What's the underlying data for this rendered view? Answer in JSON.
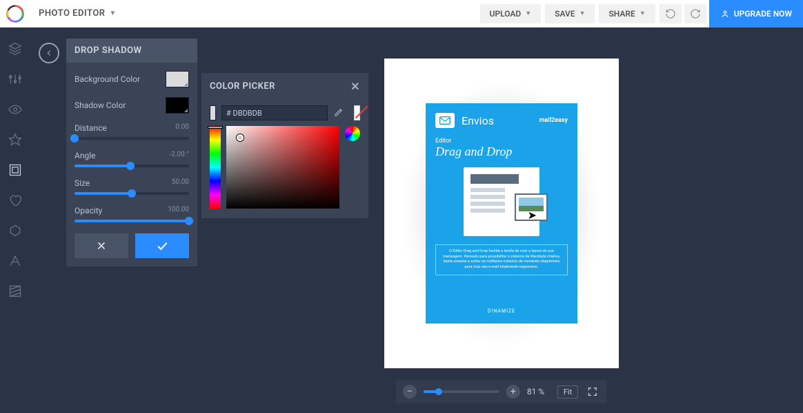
{
  "topbar": {
    "app_title": "PHOTO EDITOR",
    "upload": "UPLOAD",
    "save": "SAVE",
    "share": "SHARE",
    "upgrade": "UPGRADE NOW"
  },
  "panel": {
    "title": "DROP SHADOW",
    "bg_label": "Background Color",
    "bg_color": "#DBDBDB",
    "shadow_label": "Shadow Color",
    "shadow_color": "#000000",
    "distance_label": "Distance",
    "distance_value": "0.00",
    "distance_pct": 0,
    "angle_label": "Angle",
    "angle_value": "-2.00 °",
    "angle_pct": 49,
    "size_label": "Size",
    "size_value": "50.00",
    "size_pct": 50,
    "opacity_label": "Opacity",
    "opacity_value": "100.00",
    "opacity_pct": 100
  },
  "color_picker": {
    "title": "COLOR PICKER",
    "hex": "# DBDBDB"
  },
  "canvas": {
    "flyer_title": "Envios",
    "flyer_brand": "mail2easy",
    "flyer_sub": "Editor",
    "flyer_script": "Drag and Drop",
    "flyer_desc": "O Editor Drag and Drop facilita a tarefa de criar o layout de sua mensagem. Pensado para possibilitar o máximo de liberdade criativa, basta arrastar e soltar os múltiplos módulos de conteúdo disponíveis para criar seu e-mail totalmente responsivo.",
    "flyer_footer": "DINAMIZE"
  },
  "zoom": {
    "value": "81 %",
    "fit": "Fit",
    "pct": 20
  }
}
